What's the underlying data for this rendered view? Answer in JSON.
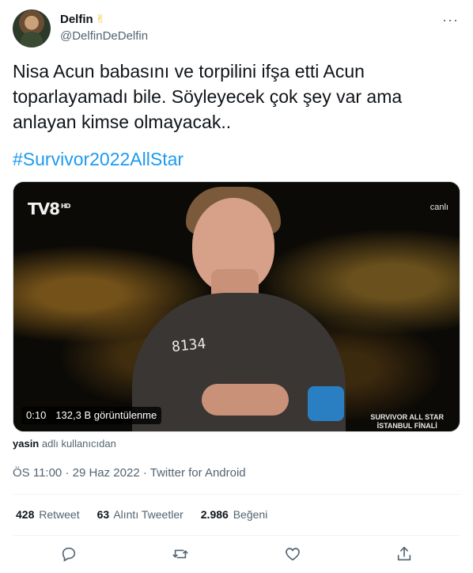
{
  "author": {
    "display_name": "Delfin",
    "emoji": "✌",
    "handle": "@DelfinDeDelfin",
    "avatar_icon": "profile-avatar"
  },
  "more_icon": "···",
  "tweet": {
    "text": "Nisa Acun babasını ve torpilini ifşa etti Acun toparlayamadı bile. Söyleyecek çok şey var ama anlayan kimse olmayacak..",
    "hashtag": "#Survivor2022AllStar"
  },
  "media": {
    "channel_logo": "TV8",
    "channel_logo_sup": "HD",
    "live_label": "canlı",
    "show_title_line1": "SURVIVOR ALL STAR",
    "show_title_line2": "İSTANBUL FİNALİ",
    "jersey_number": "8134",
    "duration": "0:10",
    "views": "132,3 B görüntülenme"
  },
  "attribution": {
    "user": "yasin",
    "suffix": "adlı kullanıcıdan"
  },
  "meta": {
    "time": "ÖS 11:00",
    "date": "29 Haz 2022",
    "source": "Twitter for Android",
    "separator": "·"
  },
  "stats": {
    "retweets_count": "428",
    "retweets_label": "Retweet",
    "quotes_count": "63",
    "quotes_label": "Alıntı Tweetler",
    "likes_count": "2.986",
    "likes_label": "Beğeni"
  },
  "colors": {
    "accent": "#1d9bf0",
    "secondary_text": "#536471",
    "primary_text": "#0f1419"
  }
}
